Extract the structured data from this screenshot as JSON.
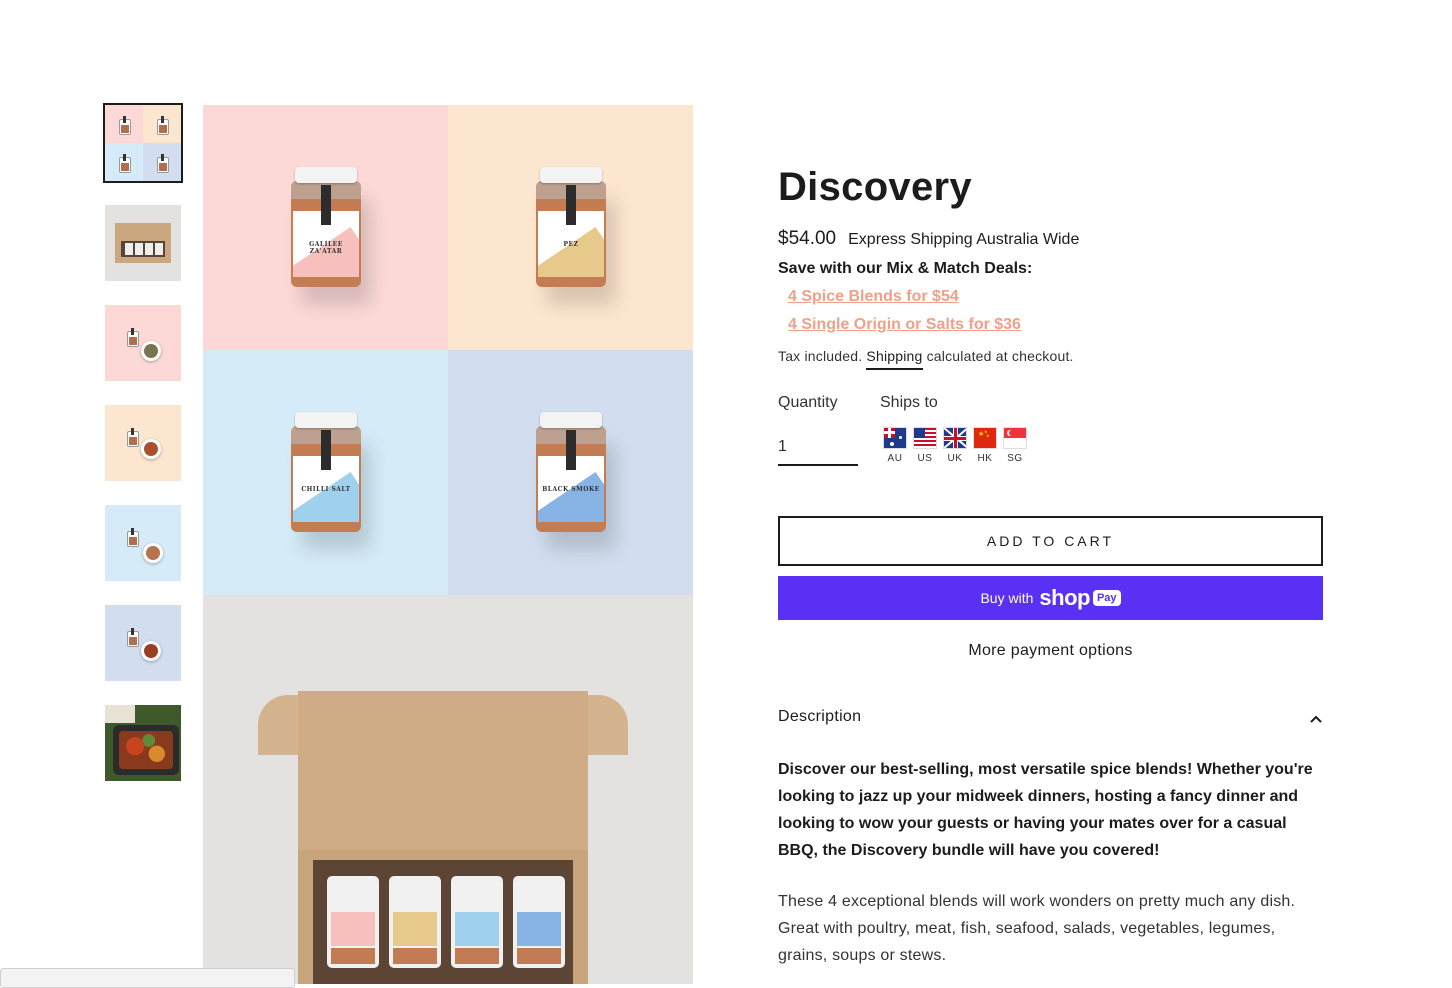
{
  "product": {
    "title": "Discovery",
    "price": "$54.00",
    "shipping_note": "Express Shipping Australia Wide",
    "save_heading": "Save with our Mix & Match Deals:",
    "deals": [
      "4 Spice Blends for $54",
      "4 Single Origin or Salts for $36"
    ],
    "tax_prefix": "Tax included.",
    "tax_link": "Shipping",
    "tax_suffix": "calculated at checkout."
  },
  "options": {
    "quantity_label": "Quantity",
    "quantity_value": "1",
    "ships_to_label": "Ships to",
    "flags": [
      {
        "code": "AU",
        "icon": "australia-flag-icon"
      },
      {
        "code": "US",
        "icon": "usa-flag-icon"
      },
      {
        "code": "UK",
        "icon": "uk-flag-icon"
      },
      {
        "code": "HK",
        "icon": "hong-kong-flag-icon"
      },
      {
        "code": "SG",
        "icon": "singapore-flag-icon"
      }
    ]
  },
  "actions": {
    "add_to_cart": "ADD TO CART",
    "buy_with": "Buy with",
    "shop": "shop",
    "pay": "Pay",
    "more_payment": "More payment options"
  },
  "description": {
    "label": "Description",
    "lead": "Discover our best-selling, most versatile spice blends! Whether you're looking to jazz up your midweek dinners, hosting a fancy dinner and looking to wow your guests or having your mates over for a casual BBQ, the Discovery bundle will have you covered!",
    "body": "These 4 exceptional blends will work wonders on pretty much any dish. Great with poultry, meat, fish, seafood, salads, vegetables, legumes, grains, soups or stews."
  },
  "gallery": {
    "jars": [
      {
        "name": "GALILEE ZA'ATAR",
        "bg": "#fcd9d7",
        "accent": "#f7c0bc"
      },
      {
        "name": "PEZ",
        "bg": "#fde6cf",
        "accent": "#e8c98c"
      },
      {
        "name": "CHILLI SALT",
        "bg": "#d5ecf8",
        "accent": "#9fd1ee"
      },
      {
        "name": "BLACK SMOKE",
        "bg": "#d2deef",
        "accent": "#87b4e4"
      }
    ]
  },
  "colors": {
    "accent_link": "#f0a08a",
    "shop_pay": "#5a31f4",
    "text": "#1c1c1c"
  }
}
